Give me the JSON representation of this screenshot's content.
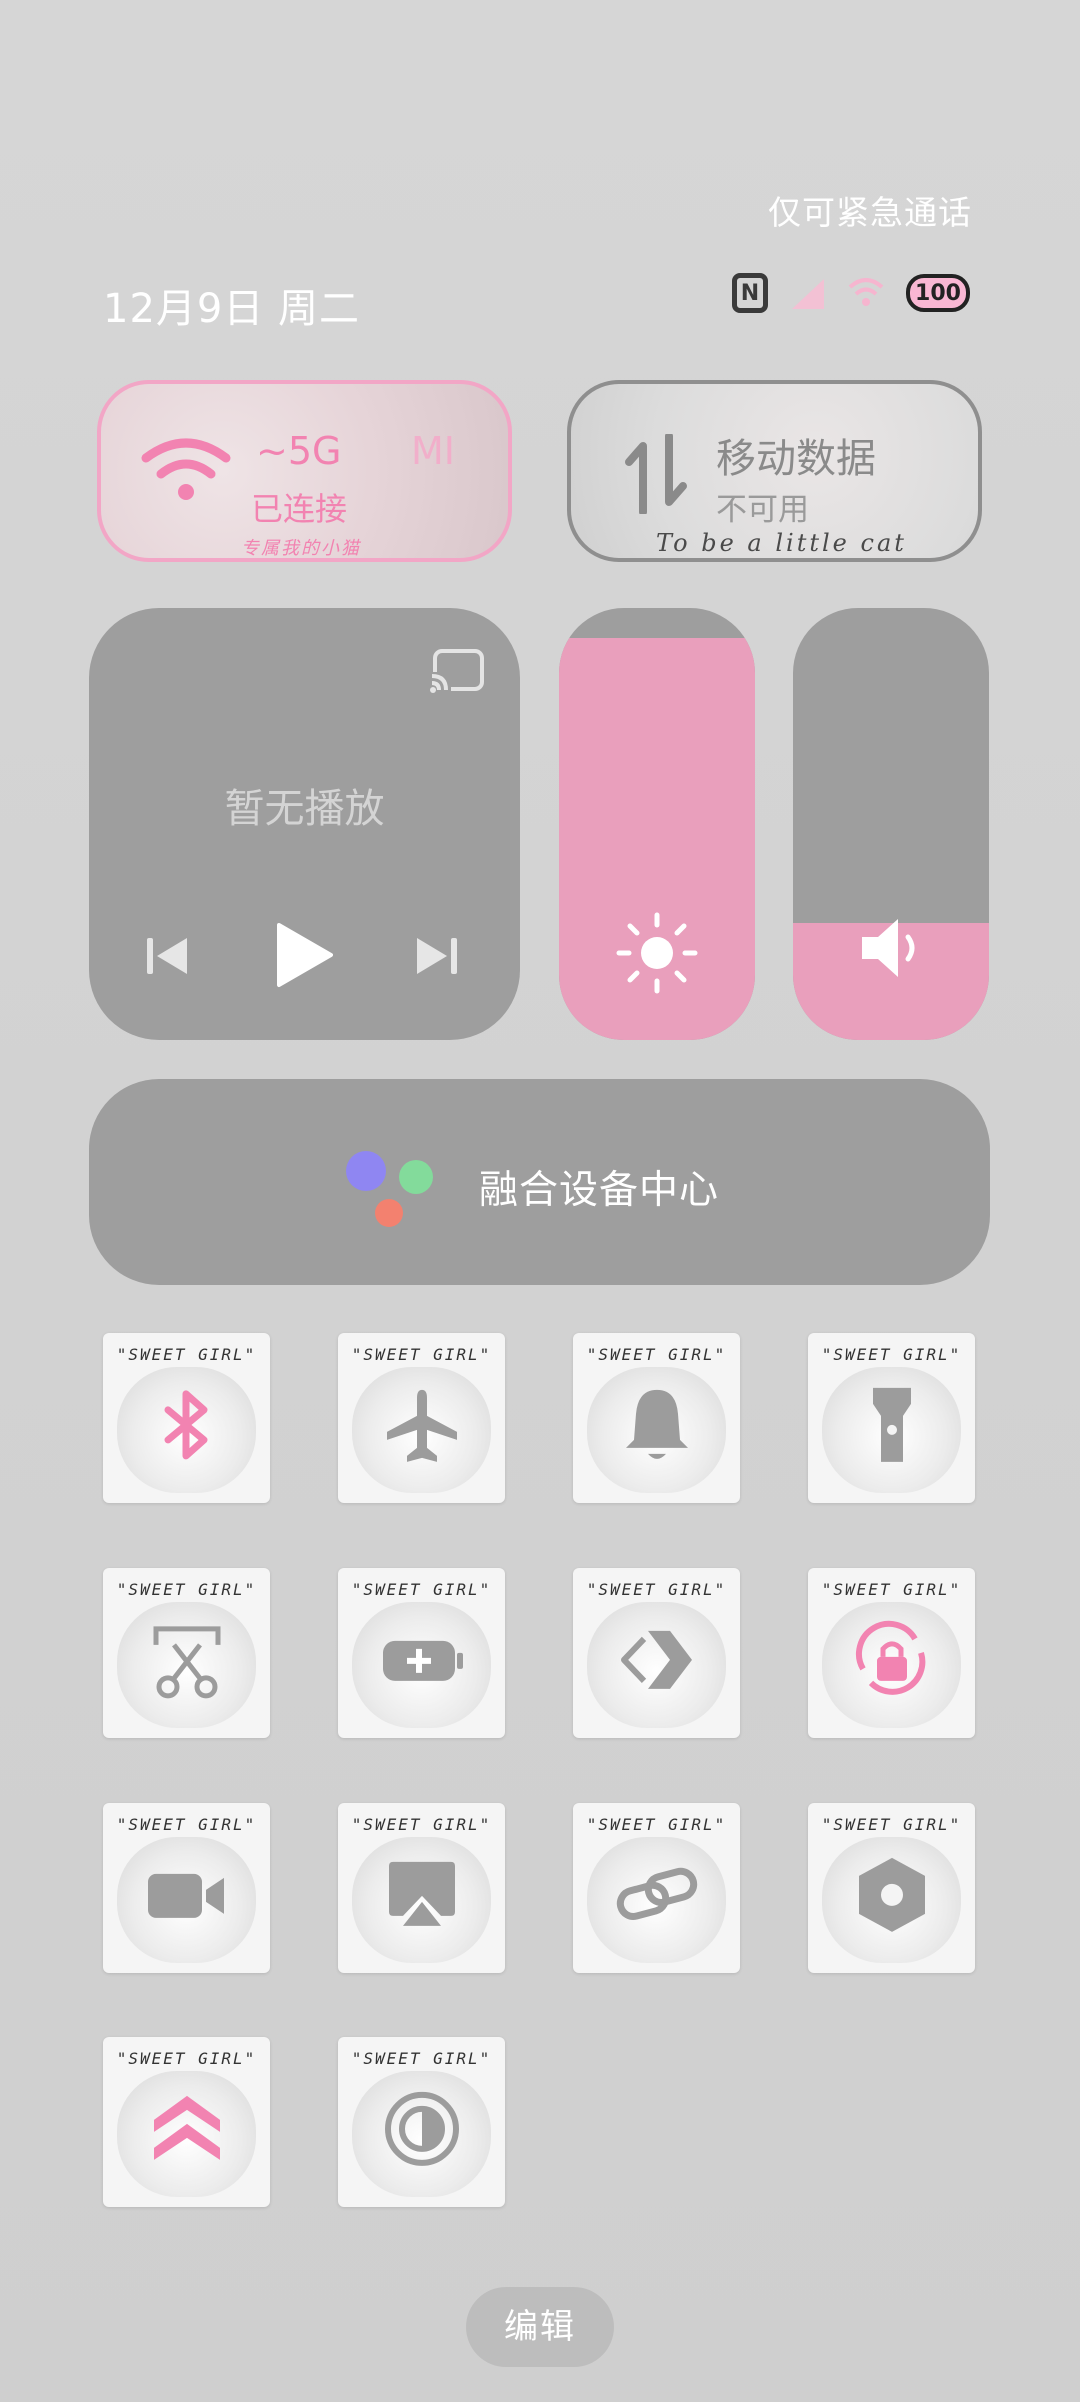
{
  "header": {
    "emergency_text": "仅可紧急通话",
    "date": "12月9日 周二"
  },
  "status_bar": {
    "nfc_icon": "nfc-icon",
    "battery_level": "100"
  },
  "wifi_tile": {
    "name": "~5G",
    "name_extra": "MI",
    "status": "已连接",
    "caption": "专属我的小猫"
  },
  "data_tile": {
    "title": "移动数据",
    "status": "不可用",
    "caption": "To be a little cat"
  },
  "media": {
    "status": "暂无播放"
  },
  "brightness": {
    "level": 0.93
  },
  "volume": {
    "level": 0.27
  },
  "fusion": {
    "label": "融合设备中心"
  },
  "tile_caption": "\"SWEET GIRL\"",
  "tiles": [
    {
      "icon": "bluetooth-icon",
      "active": true
    },
    {
      "icon": "airplane-icon",
      "active": false
    },
    {
      "icon": "bell-icon",
      "active": false
    },
    {
      "icon": "flashlight-icon",
      "active": false
    },
    {
      "icon": "screenshot-scissor-icon",
      "active": false
    },
    {
      "icon": "battery-saver-icon",
      "active": false
    },
    {
      "icon": "code-arrow-icon",
      "active": false
    },
    {
      "icon": "rotation-lock-icon",
      "active": true
    },
    {
      "icon": "screen-record-icon",
      "active": false
    },
    {
      "icon": "screen-cast-icon",
      "active": false
    },
    {
      "icon": "link-icon",
      "active": false
    },
    {
      "icon": "settings-hex-icon",
      "active": false
    },
    {
      "icon": "double-chevron-up-icon",
      "active": true
    },
    {
      "icon": "dark-mode-icon",
      "active": false
    }
  ],
  "colors": {
    "pink": "#f283b1",
    "gray_icon": "#9c9c9c",
    "panel_gray": "#9e9e9e",
    "slider_fill": "#e99fbc"
  },
  "footer": {
    "edit_label": "编辑"
  }
}
